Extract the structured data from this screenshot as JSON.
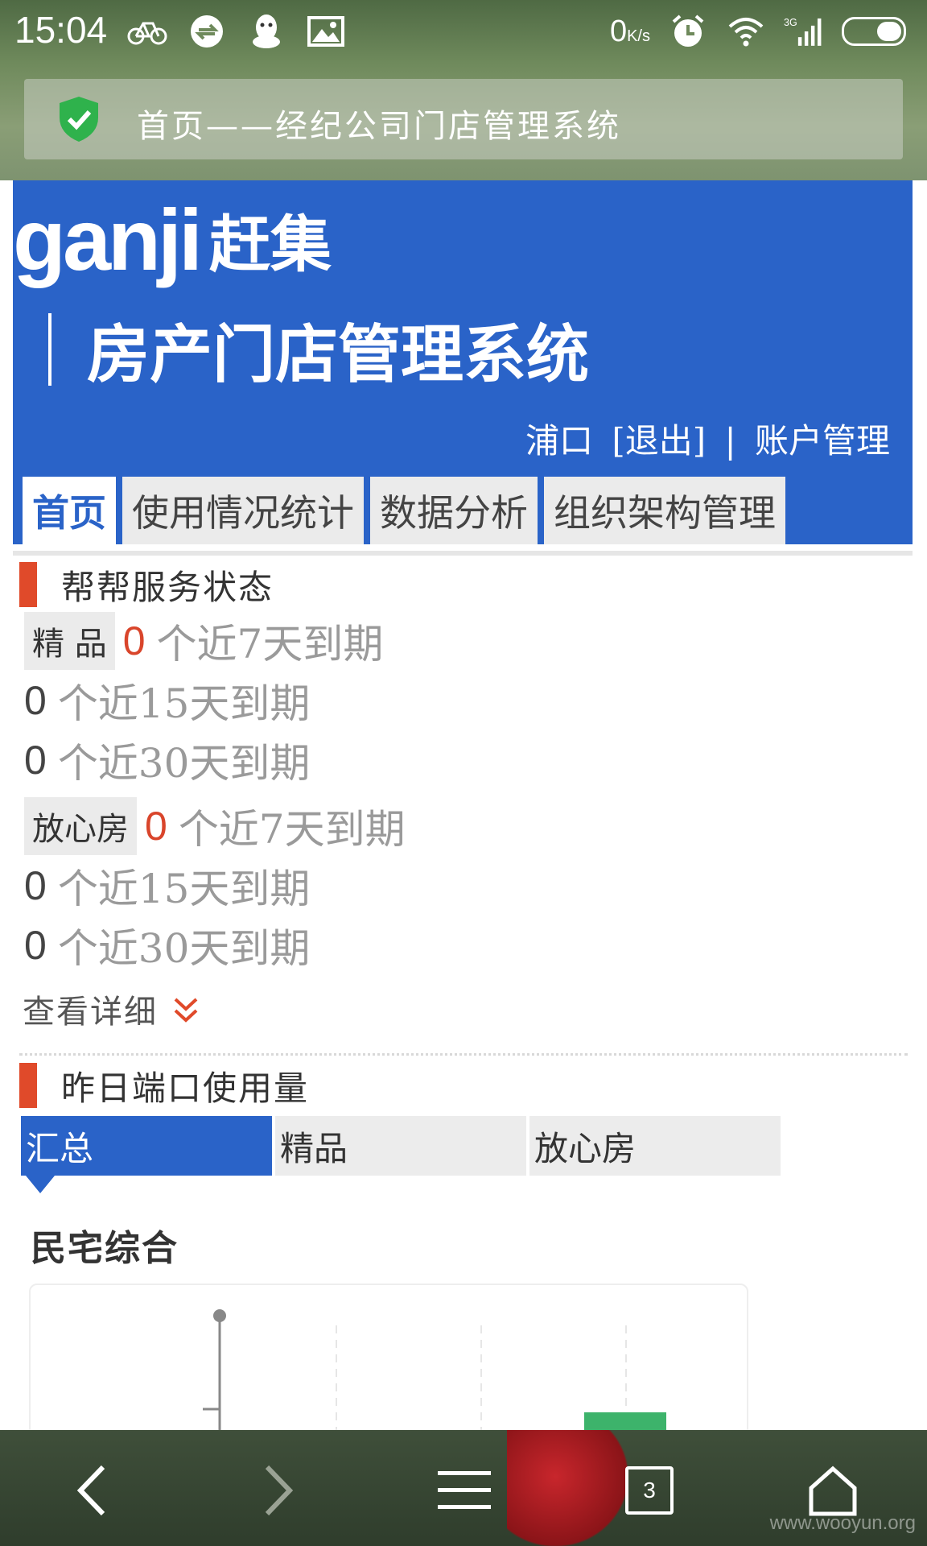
{
  "status_bar": {
    "time": "15:04",
    "net_speed_value": "0",
    "net_speed_unit": "K/s",
    "icons_left": [
      "bicycle-icon",
      "sync-icon",
      "qq-icon",
      "image-icon"
    ],
    "icons_right": [
      "alarm-icon",
      "wifi-icon",
      "signal-3g-icon",
      "battery-icon"
    ]
  },
  "browser": {
    "page_title": "首页——经纪公司门店管理系统",
    "tab_count": "3",
    "watermark": "www.wooyun.org"
  },
  "header": {
    "logo_latin": "ganji",
    "logo_cn": "赶集",
    "system_name": "房产门店管理系统",
    "username": "浦口",
    "logout": "[退出]",
    "separator": "|",
    "account": "账户管理"
  },
  "nav": {
    "tabs": [
      {
        "label": "首页",
        "active": true
      },
      {
        "label": "使用情况统计",
        "active": false
      },
      {
        "label": "数据分析",
        "active": false
      },
      {
        "label": "组织架构管理",
        "active": false
      }
    ]
  },
  "service_status": {
    "title": "帮帮服务状态",
    "groups": [
      {
        "tag": "精 品",
        "rows": [
          {
            "count": "0",
            "text": "个近7天到期"
          },
          {
            "count": "0",
            "text": "个近15天到期"
          },
          {
            "count": "0",
            "text": "个近30天到期"
          }
        ]
      },
      {
        "tag": "放心房",
        "rows": [
          {
            "count": "0",
            "text": "个近7天到期"
          },
          {
            "count": "0",
            "text": "个近15天到期"
          },
          {
            "count": "0",
            "text": "个近30天到期"
          }
        ]
      }
    ],
    "detail_link": "查看详细"
  },
  "usage": {
    "title": "昨日端口使用量",
    "tabs": [
      {
        "label": "汇总",
        "active": true
      },
      {
        "label": "精品",
        "active": false
      },
      {
        "label": "放心房",
        "active": false
      }
    ],
    "chart_title": "民宅综合",
    "bar_color": "#3db36b"
  },
  "colors": {
    "brand_blue": "#2a63c8",
    "accent_red": "#e04a2a",
    "count_red": "#d9452b"
  }
}
